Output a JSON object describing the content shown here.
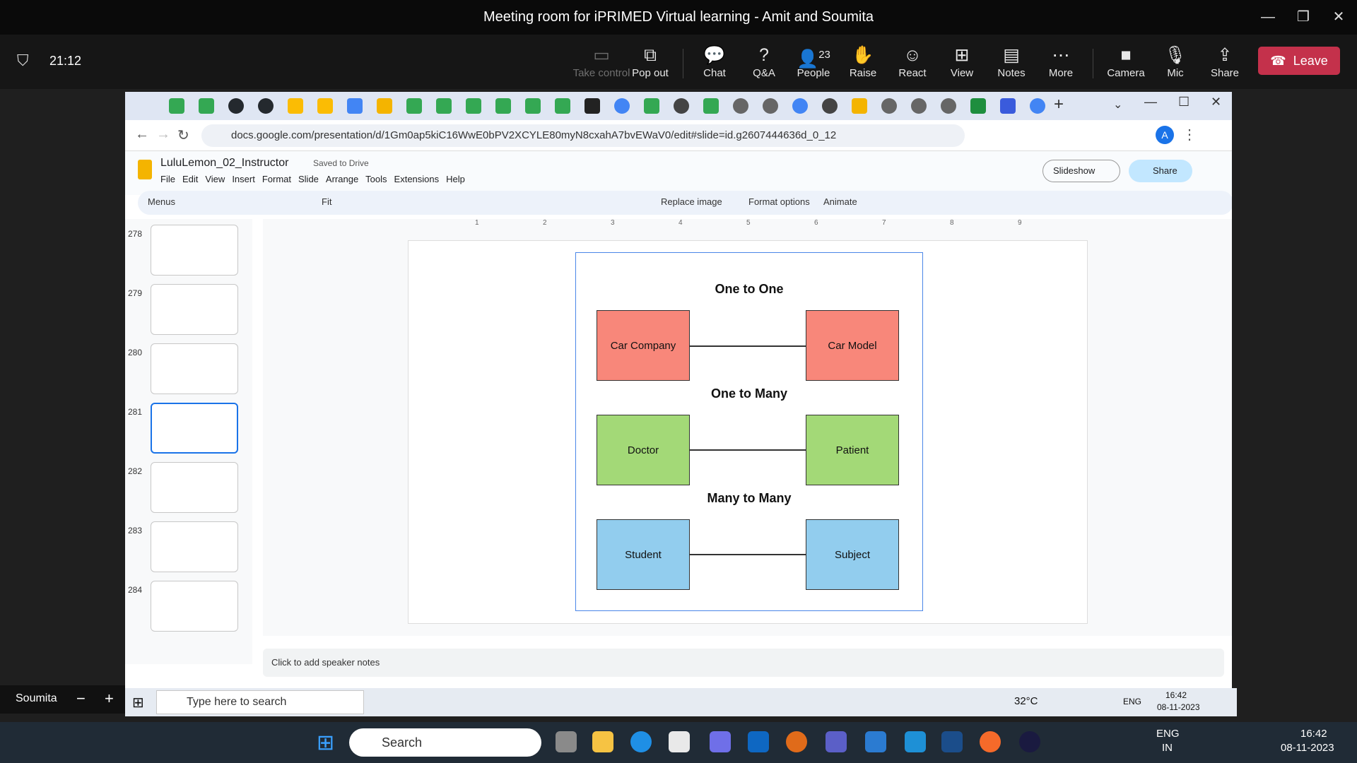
{
  "teams": {
    "title": "Meeting room for iPRIMED Virtual learning - Amit and Soumita",
    "timer": "21:12",
    "toolbar": [
      {
        "label": "Take control",
        "icon": "take-control-icon"
      },
      {
        "label": "Pop out",
        "icon": "pop-out-icon"
      },
      {
        "label": "Chat",
        "icon": "chat-icon"
      },
      {
        "label": "Q&A",
        "icon": "qna-icon"
      },
      {
        "label": "People",
        "icon": "people-icon",
        "badge": "23"
      },
      {
        "label": "Raise",
        "icon": "raise-hand-icon"
      },
      {
        "label": "React",
        "icon": "react-icon"
      },
      {
        "label": "View",
        "icon": "view-icon"
      },
      {
        "label": "Notes",
        "icon": "notes-icon"
      },
      {
        "label": "More",
        "icon": "more-icon"
      },
      {
        "label": "Camera",
        "icon": "camera-icon"
      },
      {
        "label": "Mic",
        "icon": "mic-off-icon"
      },
      {
        "label": "Share",
        "icon": "share-icon"
      }
    ],
    "leave_label": "Leave",
    "participant_name": "Soumita"
  },
  "browser": {
    "url": "docs.google.com/presentation/d/1Gm0ap5kiC16WwE0bPV2XCYLE80myN8cxahA7bvEWaV0/edit#slide=id.g2607444636d_0_12",
    "profile_initial": "A"
  },
  "docs": {
    "file_name": "LuluLemon_02_Instructor",
    "saved_status": "Saved to Drive",
    "menu": [
      "File",
      "Edit",
      "View",
      "Insert",
      "Format",
      "Slide",
      "Arrange",
      "Tools",
      "Extensions",
      "Help"
    ],
    "slideshow_label": "Slideshow",
    "share_label": "Share",
    "toolbar": {
      "menus": "Menus",
      "zoom": "Fit",
      "replace_image": "Replace image",
      "format_options": "Format options",
      "animate": "Animate"
    },
    "ruler": [
      "1",
      "2",
      "3",
      "4",
      "5",
      "6",
      "7",
      "8",
      "9"
    ],
    "slide_numbers": [
      "278",
      "279",
      "280",
      "281",
      "282",
      "283",
      "284"
    ],
    "speaker_notes": "Click to add speaker notes"
  },
  "diagram": {
    "sections": [
      {
        "title": "One to One",
        "left": "Car Company",
        "right": "Car Model",
        "left_color": "#f8877a",
        "right_color": "#f8877a"
      },
      {
        "title": "One to Many",
        "left": "Doctor",
        "right": "Patient",
        "left_color": "#a3d977",
        "right_color": "#a3d977"
      },
      {
        "title": "Many to Many",
        "left": "Student",
        "right": "Subject",
        "left_color": "#92cdee",
        "right_color": "#92cdee"
      }
    ]
  },
  "inner_taskbar": {
    "search_placeholder": "Type here to search",
    "weather": "32°C",
    "lang": "ENG",
    "time": "16:42",
    "date": "08-11-2023"
  },
  "taskbar": {
    "search_placeholder": "Search",
    "lang": "ENG",
    "region": "IN",
    "time": "16:42",
    "date": "08-11-2023"
  }
}
